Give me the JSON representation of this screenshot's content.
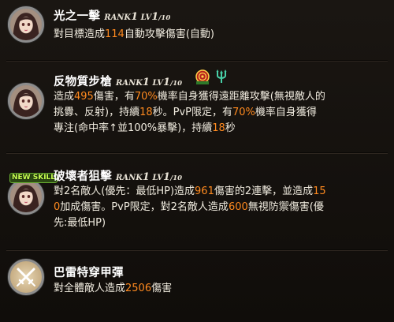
{
  "skills": [
    {
      "name": "光之一擊",
      "rank_label": "RANK",
      "rank": "1",
      "lv_label": "LV",
      "lv": "1",
      "lv_max": "/10",
      "lines": [
        [
          "對目標造成",
          "114",
          "自動攻擊傷害(自動)"
        ]
      ]
    },
    {
      "name": "反物質步槍",
      "rank_label": "RANK",
      "rank": "1",
      "lv_label": "LV",
      "lv": "1",
      "lv_max": "/10",
      "line1": [
        "造成",
        "495",
        "傷害，有",
        "70%",
        "機率自身獲得遠距離攻擊(無視敵人的"
      ],
      "line2": "挑釁、反射)，持續18秒。PvP限定，有70%機率自身獲得",
      "line2_parts": [
        "挑釁、反射)，持續",
        "18",
        "秒。PvP限定，有",
        "70%",
        "機率自身獲得"
      ],
      "line3_parts": [
        "專注(命中率↑並100%暴擊)，持續",
        "18",
        "秒"
      ]
    },
    {
      "name": "破壞者狙擊",
      "rank_label": "RANK",
      "rank": "1",
      "lv_label": "LV",
      "lv": "1",
      "lv_max": "/10",
      "badge": "NEW SKILL",
      "line1_parts": [
        "對2名敵人(優先：最低HP)造成",
        "961",
        "傷害的2連擊，並造成",
        "15"
      ],
      "line2_parts": [
        "0",
        "加成傷害。PvP限定，對2名敵人造成",
        "600",
        "無視防禦傷害(優"
      ],
      "line3": "先:最低HP)"
    },
    {
      "name": "巴雷特穿甲彈",
      "line1_parts": [
        "對全體敵人造成",
        "2506",
        "傷害"
      ]
    }
  ],
  "colors": {
    "highlight": "#ff8a1f",
    "title": "#ffffff",
    "text": "#f0ebdf",
    "background": "#14110e"
  },
  "icons": [
    "portrait-avatar-icon",
    "target-buff-icon",
    "trident-buff-icon",
    "crossed-swords-icon"
  ]
}
